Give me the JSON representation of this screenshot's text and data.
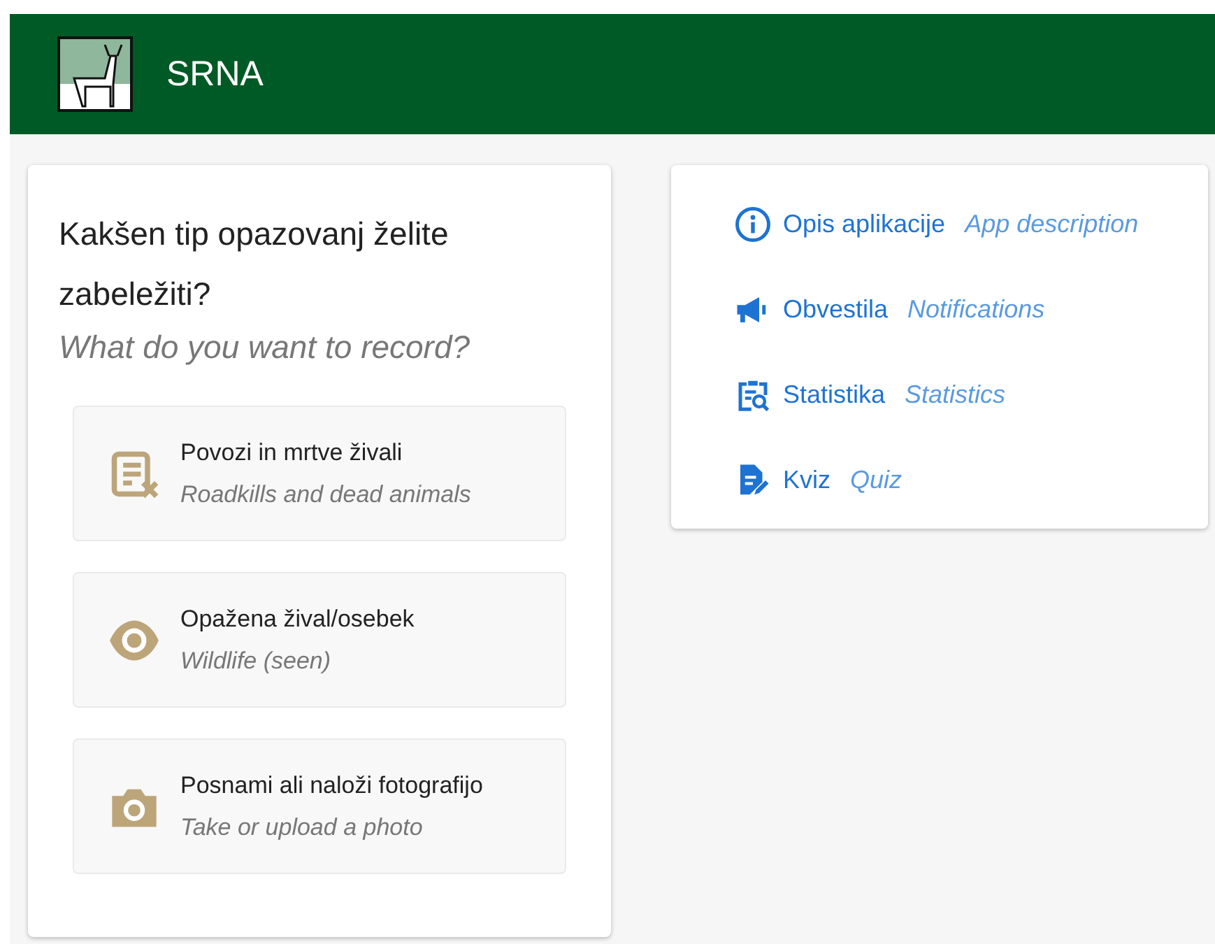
{
  "header": {
    "title": "SRNA"
  },
  "record_card": {
    "title": "Kakšen tip opazovanj želite zabeležiti?",
    "subtitle": "What do you want to record?",
    "options": [
      {
        "kind": "report",
        "label": "Povozi in mrtve živali",
        "sublabel": "Roadkills and dead animals"
      },
      {
        "kind": "eye",
        "label": "Opažena žival/osebek",
        "sublabel": "Wildlife (seen)"
      },
      {
        "kind": "camera",
        "label": "Posnami ali naloži fotografijo",
        "sublabel": "Take or upload a photo"
      }
    ]
  },
  "links": [
    {
      "kind": "info",
      "label": "Opis aplikacije",
      "sublabel": "App description"
    },
    {
      "kind": "megaphone",
      "label": "Obvestila",
      "sublabel": "Notifications"
    },
    {
      "kind": "clipboard",
      "label": "Statistika",
      "sublabel": "Statistics"
    },
    {
      "kind": "document",
      "label": "Kviz",
      "sublabel": "Quiz"
    }
  ]
}
